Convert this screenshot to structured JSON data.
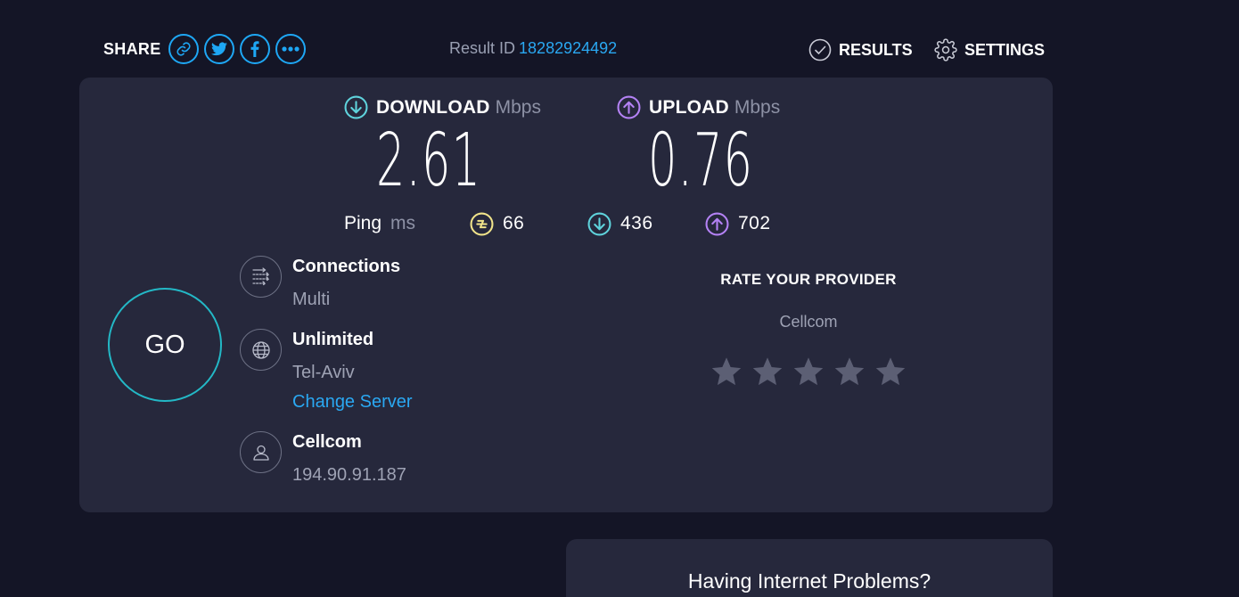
{
  "header": {
    "share_label": "SHARE",
    "share_icons": [
      "link-icon",
      "twitter-icon",
      "facebook-icon",
      "more-icon"
    ],
    "result_label": "Result ID",
    "result_id": "18282924492",
    "results_label": "RESULTS",
    "settings_label": "SETTINGS"
  },
  "metrics": {
    "download": {
      "label": "DOWNLOAD",
      "unit": "Mbps",
      "value": "2.61"
    },
    "upload": {
      "label": "UPLOAD",
      "unit": "Mbps",
      "value": "0.76"
    }
  },
  "ping": {
    "label": "Ping",
    "unit": "ms",
    "idle": "66",
    "download": "436",
    "upload": "702"
  },
  "go_label": "GO",
  "connection": {
    "connections_title": "Connections",
    "connections_value": "Multi",
    "server_title": "Unlimited",
    "server_location": "Tel-Aviv",
    "change_server": "Change Server",
    "isp_title": "Cellcom",
    "ip": "194.90.91.187"
  },
  "rating": {
    "title": "RATE YOUR PROVIDER",
    "provider": "Cellcom",
    "stars_filled": 0,
    "stars_total": 5
  },
  "bottom_card": {
    "title": "Having Internet Problems?"
  },
  "colors": {
    "background": "#141526",
    "card": "#26283c",
    "accent_blue": "#1ea7f5",
    "download": "#5fd3dc",
    "upload": "#b482f5",
    "jitter": "#f0e38a",
    "go_ring": "#23b8c6",
    "star_empty": "#5c5f74"
  }
}
